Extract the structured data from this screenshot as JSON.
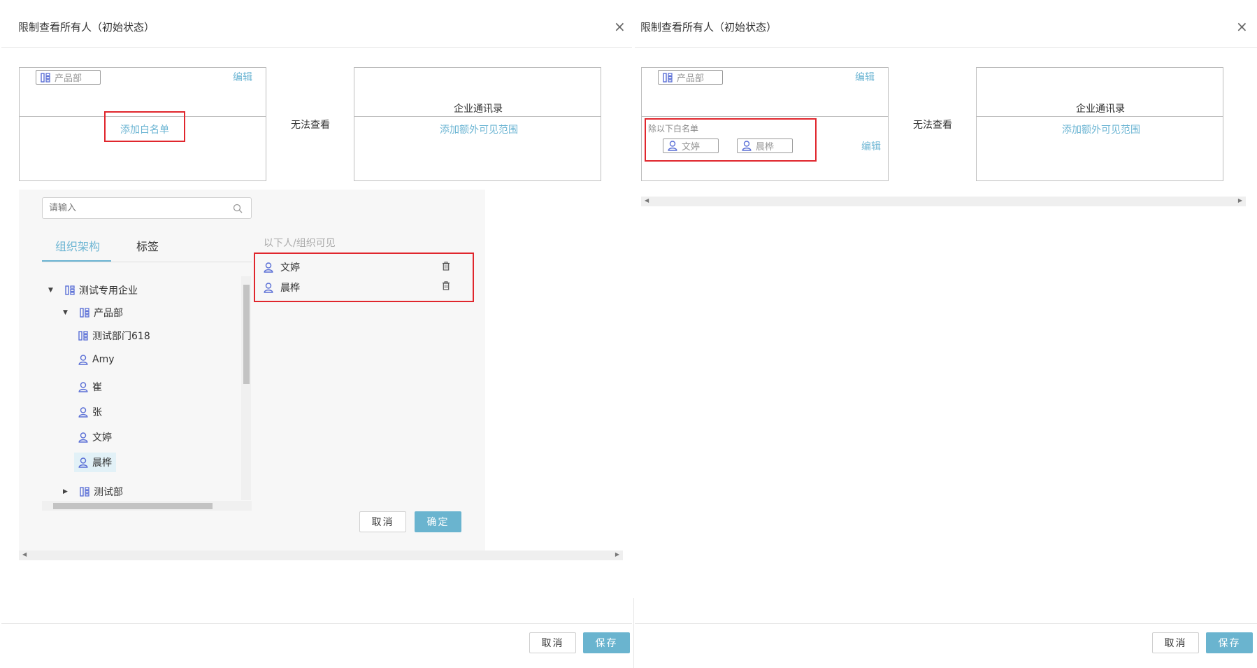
{
  "left_dialog": {
    "title": "限制查看所有人（初始状态）",
    "rule_box": {
      "dept_tag": "产品部",
      "edit_label": "编辑",
      "add_whitelist_label": "添加白名单"
    },
    "middle_text": "无法查看",
    "target_box": {
      "title": "企业通讯录",
      "add_scope_label": "添加额外可见范围"
    },
    "picker": {
      "search_placeholder": "请输入",
      "tabs": [
        {
          "label": "组织架构"
        },
        {
          "label": "标签"
        }
      ],
      "tree": [
        {
          "label": "测试专用企业",
          "type": "dept",
          "expander": "expanded"
        },
        {
          "label": "产品部",
          "type": "dept",
          "expander": "expanded"
        },
        {
          "label": "测试部门618",
          "type": "dept"
        },
        {
          "label": "Amy",
          "type": "user"
        },
        {
          "label": "崔",
          "type": "user"
        },
        {
          "label": "张",
          "type": "user"
        },
        {
          "label": "文婷",
          "type": "user"
        },
        {
          "label": "晨桦",
          "type": "user",
          "selected": true
        },
        {
          "label": "测试部",
          "type": "dept",
          "expander": "collapsed"
        }
      ],
      "selected_heading": "以下人/组织可见",
      "selected": [
        {
          "label": "文婷"
        },
        {
          "label": "晨桦"
        }
      ],
      "cancel_label": "取消",
      "confirm_label": "确定"
    },
    "footer": {
      "cancel_label": "取消",
      "save_label": "保存"
    }
  },
  "right_dialog": {
    "title": "限制查看所有人（初始状态）",
    "rule_box": {
      "dept_tag": "产品部",
      "edit_label": "编辑",
      "whitelist_heading": "除以下白名单",
      "whitelist": [
        {
          "label": "文婷"
        },
        {
          "label": "晨桦"
        }
      ],
      "whitelist_edit_label": "编辑"
    },
    "middle_text": "无法查看",
    "target_box": {
      "title": "企业通讯录",
      "add_scope_label": "添加额外可见范围"
    },
    "footer": {
      "cancel_label": "取消",
      "save_label": "保存"
    }
  },
  "colors": {
    "accent": "#6ab4cf",
    "link": "#6cb5d3",
    "icon": "#5a6fd6",
    "highlight": "#e0262d"
  }
}
